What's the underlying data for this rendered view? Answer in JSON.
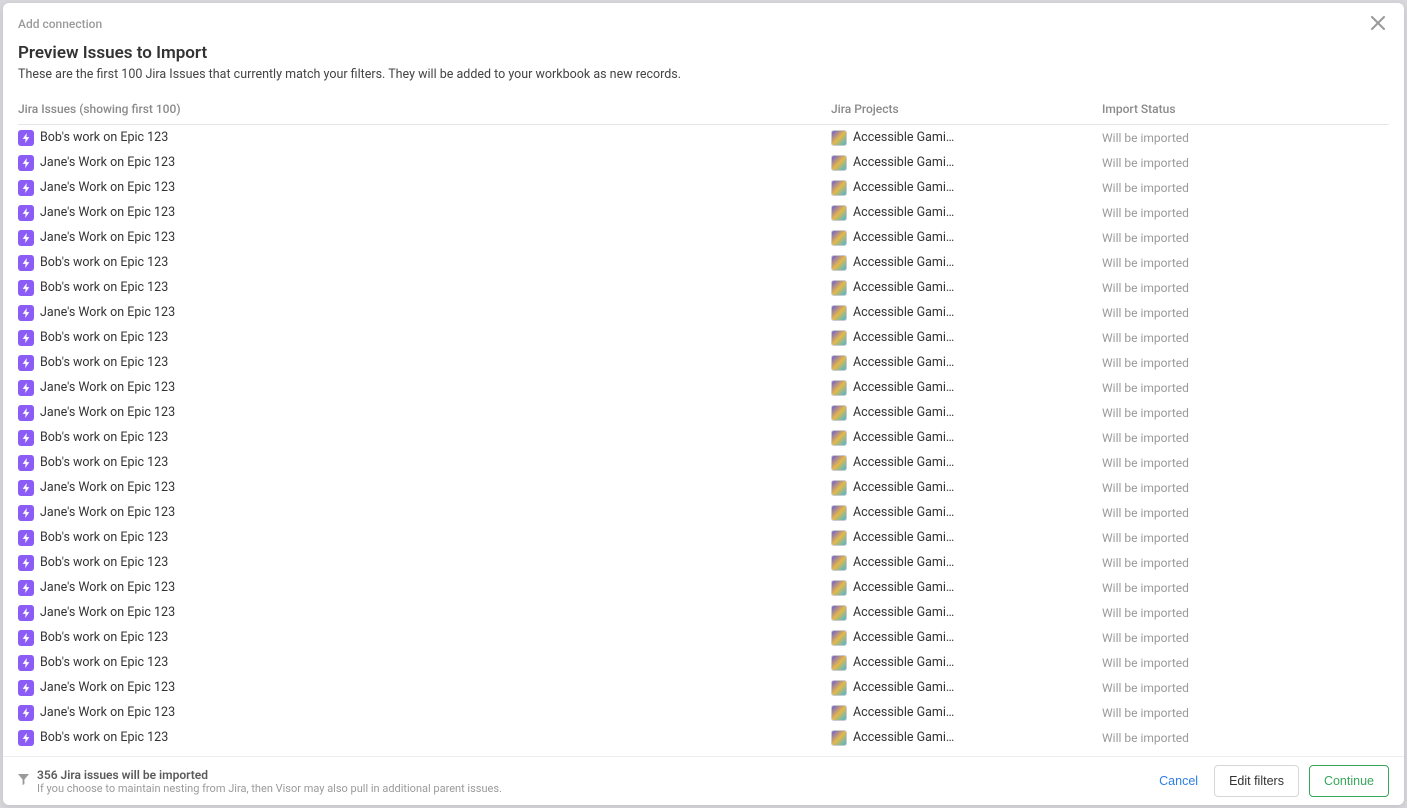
{
  "header": {
    "crumb": "Add connection"
  },
  "titlebar": {
    "title": "Preview Issues to Import",
    "subtitle": "These are the first 100 Jira Issues that currently match your filters. They will be added to your workbook as new records."
  },
  "columns": {
    "issue": "Jira Issues (showing first 100)",
    "project": "Jira Projects",
    "status": "Import Status"
  },
  "rows": [
    {
      "title": "Bob's work on Epic 123",
      "project": "Accessible Gami…",
      "status": "Will be imported"
    },
    {
      "title": "Jane's Work on Epic 123",
      "project": "Accessible Gami…",
      "status": "Will be imported"
    },
    {
      "title": "Jane's Work on Epic 123",
      "project": "Accessible Gami…",
      "status": "Will be imported"
    },
    {
      "title": "Jane's Work on Epic 123",
      "project": "Accessible Gami…",
      "status": "Will be imported"
    },
    {
      "title": "Jane's Work on Epic 123",
      "project": "Accessible Gami…",
      "status": "Will be imported"
    },
    {
      "title": "Bob's work on Epic 123",
      "project": "Accessible Gami…",
      "status": "Will be imported"
    },
    {
      "title": "Bob's work on Epic 123",
      "project": "Accessible Gami…",
      "status": "Will be imported"
    },
    {
      "title": "Jane's Work on Epic 123",
      "project": "Accessible Gami…",
      "status": "Will be imported"
    },
    {
      "title": "Bob's work on Epic 123",
      "project": "Accessible Gami…",
      "status": "Will be imported"
    },
    {
      "title": "Bob's work on Epic 123",
      "project": "Accessible Gami…",
      "status": "Will be imported"
    },
    {
      "title": "Jane's Work on Epic 123",
      "project": "Accessible Gami…",
      "status": "Will be imported"
    },
    {
      "title": "Jane's Work on Epic 123",
      "project": "Accessible Gami…",
      "status": "Will be imported"
    },
    {
      "title": "Bob's work on Epic 123",
      "project": "Accessible Gami…",
      "status": "Will be imported"
    },
    {
      "title": "Bob's work on Epic 123",
      "project": "Accessible Gami…",
      "status": "Will be imported"
    },
    {
      "title": "Jane's Work on Epic 123",
      "project": "Accessible Gami…",
      "status": "Will be imported"
    },
    {
      "title": "Jane's Work on Epic 123",
      "project": "Accessible Gami…",
      "status": "Will be imported"
    },
    {
      "title": "Bob's work on Epic 123",
      "project": "Accessible Gami…",
      "status": "Will be imported"
    },
    {
      "title": "Bob's work on Epic 123",
      "project": "Accessible Gami…",
      "status": "Will be imported"
    },
    {
      "title": "Jane's Work on Epic 123",
      "project": "Accessible Gami…",
      "status": "Will be imported"
    },
    {
      "title": "Jane's Work on Epic 123",
      "project": "Accessible Gami…",
      "status": "Will be imported"
    },
    {
      "title": "Bob's work on Epic 123",
      "project": "Accessible Gami…",
      "status": "Will be imported"
    },
    {
      "title": "Bob's work on Epic 123",
      "project": "Accessible Gami…",
      "status": "Will be imported"
    },
    {
      "title": "Jane's Work on Epic 123",
      "project": "Accessible Gami…",
      "status": "Will be imported"
    },
    {
      "title": "Jane's Work on Epic 123",
      "project": "Accessible Gami…",
      "status": "Will be imported"
    },
    {
      "title": "Bob's work on Epic 123",
      "project": "Accessible Gami…",
      "status": "Will be imported"
    }
  ],
  "footer": {
    "line1": "356 Jira issues will be imported",
    "line2": "If you choose to maintain nesting from Jira, then Visor may also pull in additional parent issues."
  },
  "actions": {
    "cancel": "Cancel",
    "edit_filters": "Edit filters",
    "continue": "Continue"
  }
}
